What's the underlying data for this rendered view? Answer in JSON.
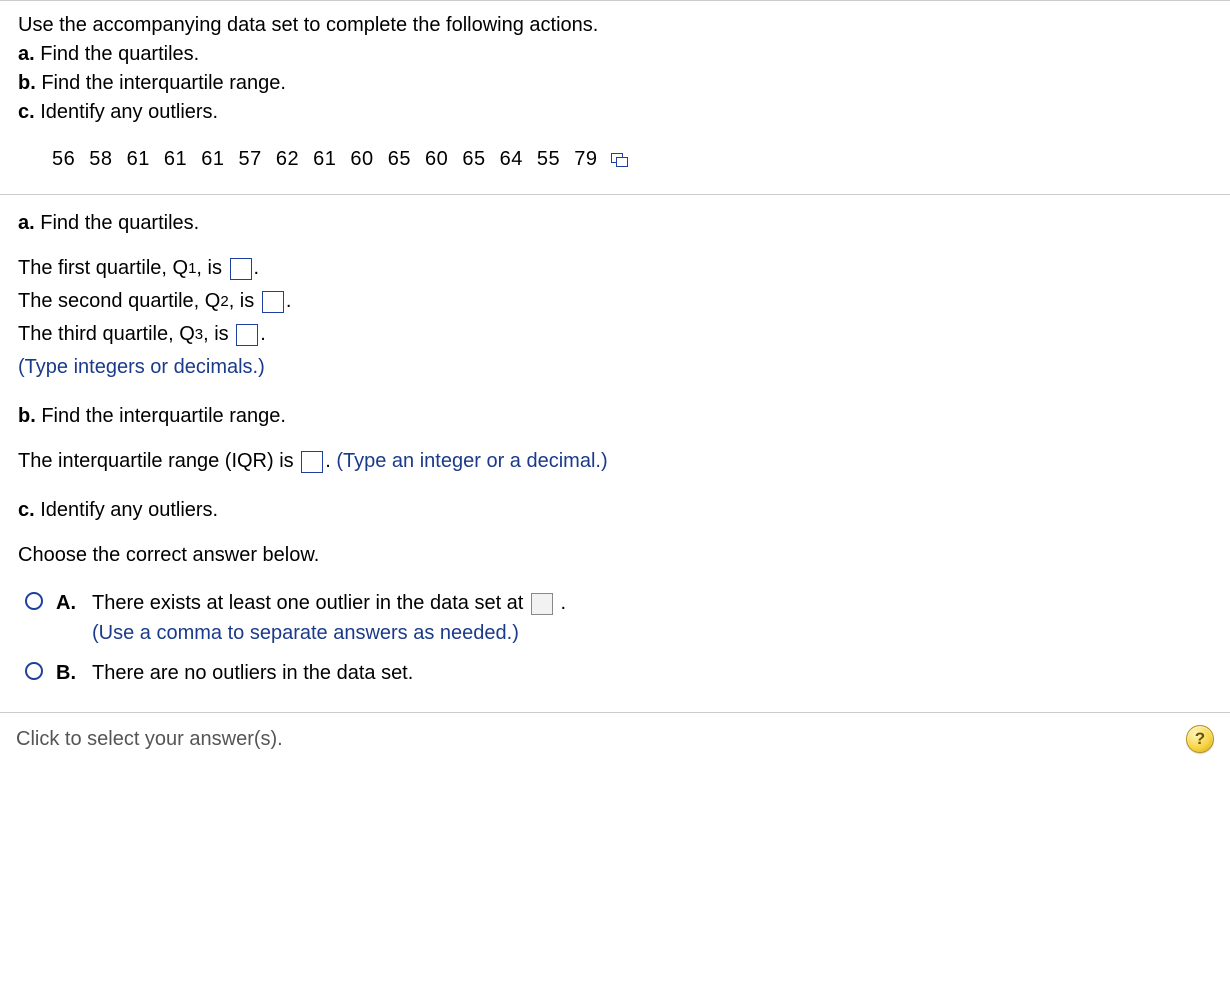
{
  "intro": {
    "line1": "Use the accompanying data set to complete the following actions.",
    "a_label": "a.",
    "a_text": " Find the quartiles.",
    "b_label": "b.",
    "b_text": " Find the interquartile range.",
    "c_label": "c.",
    "c_text": " Identify any outliers."
  },
  "data_values": "56  58  61  61  61  57  62  61  60  65  60  65  64  55  79",
  "partA": {
    "header_label": "a.",
    "header_text": " Find the quartiles.",
    "q1_pre": "The first quartile, Q",
    "q1_sub": "1",
    "q1_post": ", is ",
    "q2_pre": "The second quartile, Q",
    "q2_sub": "2",
    "q2_post": ", is ",
    "q3_pre": "The third quartile, Q",
    "q3_sub": "3",
    "q3_post": ", is ",
    "period": ".",
    "hint": "(Type integers or decimals.)"
  },
  "partB": {
    "header_label": "b.",
    "header_text": " Find the interquartile range.",
    "line_pre": "The interquartile range (IQR) is ",
    "line_post": ". ",
    "hint": "(Type an integer or a decimal.)"
  },
  "partC": {
    "header_label": "c.",
    "header_text": " Identify any outliers.",
    "choose": "Choose the correct answer below.",
    "optA_label": "A.",
    "optA_text": "There exists at least one outlier in the data set at ",
    "optA_period": ".",
    "optA_hint": "(Use a comma to separate answers as needed.)",
    "optB_label": "B.",
    "optB_text": "There are no outliers in the data set."
  },
  "footer": {
    "prompt": "Click to select your answer(s).",
    "help": "?"
  }
}
